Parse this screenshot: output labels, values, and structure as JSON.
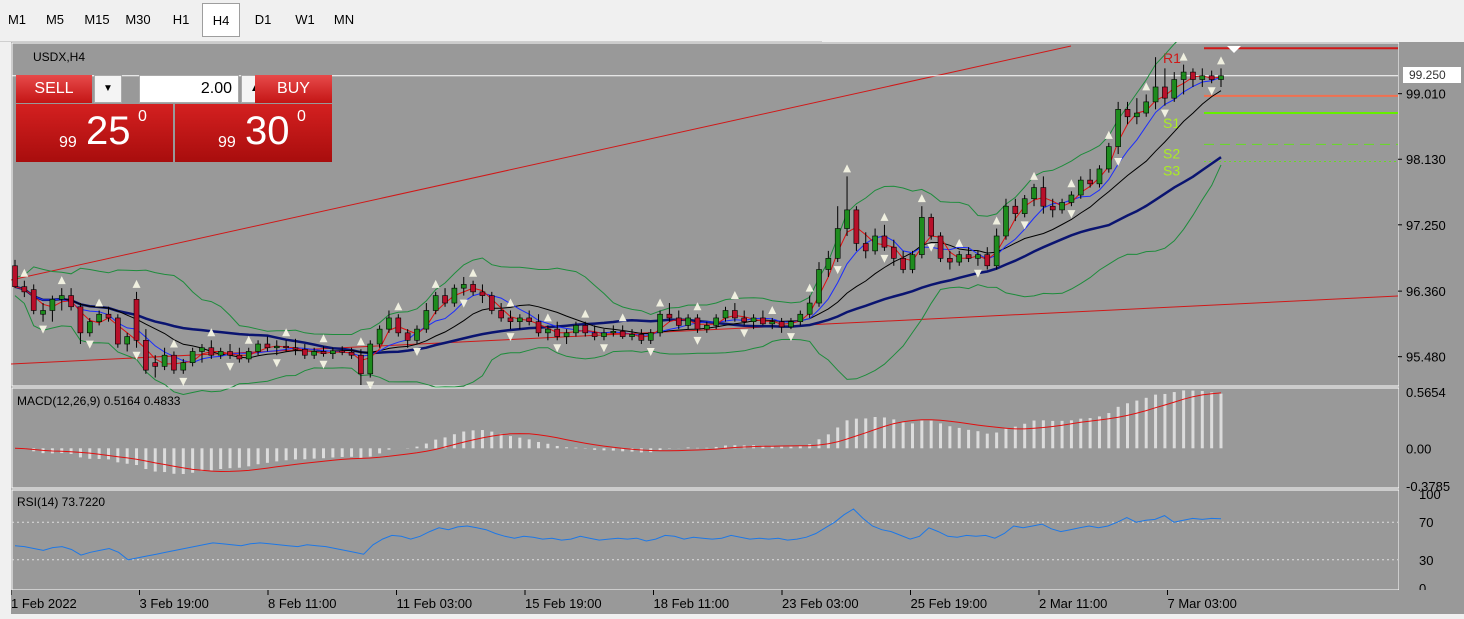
{
  "toolbar": {
    "timeframes": [
      "M1",
      "M5",
      "M15",
      "M30",
      "H1",
      "H4",
      "D1",
      "W1",
      "MN"
    ],
    "active": "H4"
  },
  "chart": {
    "symbol_label": "USDX,H4",
    "current_price_label": "99.250",
    "price_axis": [
      "99.010",
      "98.130",
      "97.250",
      "96.360",
      "95.480"
    ],
    "pivot_labels": [
      "R1",
      "S1",
      "S2",
      "S3"
    ],
    "date_axis": [
      "1 Feb 2022",
      "3 Feb 19:00",
      "8 Feb 11:00",
      "11 Feb 03:00",
      "15 Feb 19:00",
      "18 Feb 11:00",
      "23 Feb 03:00",
      "25 Feb 19:00",
      "2 Mar 11:00",
      "7 Mar 03:00"
    ]
  },
  "macd": {
    "label": "MACD(12,26,9) 0.5164 0.4833",
    "axis": [
      "0.5654",
      "0.00",
      "-0.3785"
    ]
  },
  "rsi": {
    "label": "RSI(14) 73.7220",
    "axis": [
      "100",
      "70",
      "30",
      "0"
    ]
  },
  "trade": {
    "sell_label": "SELL",
    "buy_label": "BUY",
    "lot": "2.00",
    "bid_small": "99",
    "bid_big": "25",
    "bid_sup": "0",
    "ask_small": "99",
    "ask_big": "30",
    "ask_sup": "0"
  },
  "colors": {
    "chart_bg": "#999999",
    "bull_candle": "#1e8c1e",
    "bear_candle": "#b8102a",
    "trendline": "#d01818",
    "ma_slow": "#0a1470",
    "ma_mid": "#000000",
    "ma_fast": "#1a2cff",
    "ma_red": "#e01010",
    "bollinger": "#1e8c3c",
    "macd_hist": "#dcdcdc",
    "macd_signal": "#e01010",
    "rsi_line": "#1e78e6",
    "pivot_r1": "#d01818",
    "pivot_s1": "#66ee00"
  },
  "chart_data": {
    "type": "candlestick",
    "symbol": "USDX",
    "timeframe": "H4",
    "y_range": [
      95.1,
      99.65
    ],
    "ohlc": [
      [
        96.7,
        96.78,
        96.4,
        96.42
      ],
      [
        96.42,
        96.5,
        96.28,
        96.35
      ],
      [
        96.38,
        96.45,
        96.05,
        96.1
      ],
      [
        96.05,
        96.2,
        95.95,
        96.1
      ],
      [
        96.1,
        96.3,
        95.95,
        96.25
      ],
      [
        96.25,
        96.4,
        96.1,
        96.3
      ],
      [
        96.3,
        96.4,
        96.1,
        96.15
      ],
      [
        96.15,
        96.2,
        95.65,
        95.8
      ],
      [
        95.8,
        96.0,
        95.75,
        95.95
      ],
      [
        95.95,
        96.1,
        95.9,
        96.05
      ],
      [
        96.05,
        96.15,
        95.95,
        96.0
      ],
      [
        96.0,
        96.05,
        95.6,
        95.65
      ],
      [
        95.65,
        95.8,
        95.55,
        95.75
      ],
      [
        96.25,
        96.35,
        95.6,
        95.7
      ],
      [
        95.7,
        95.85,
        95.25,
        95.3
      ],
      [
        95.4,
        95.5,
        95.2,
        95.35
      ],
      [
        95.35,
        95.6,
        95.3,
        95.5
      ],
      [
        95.5,
        95.55,
        95.25,
        95.3
      ],
      [
        95.3,
        95.45,
        95.25,
        95.4
      ],
      [
        95.4,
        95.6,
        95.35,
        95.55
      ],
      [
        95.55,
        95.65,
        95.4,
        95.6
      ],
      [
        95.6,
        95.7,
        95.45,
        95.5
      ],
      [
        95.5,
        95.6,
        95.45,
        95.55
      ],
      [
        95.55,
        95.65,
        95.45,
        95.5
      ],
      [
        95.5,
        95.6,
        95.4,
        95.45
      ],
      [
        95.45,
        95.6,
        95.4,
        95.55
      ],
      [
        95.55,
        95.7,
        95.5,
        95.65
      ],
      [
        95.65,
        95.75,
        95.55,
        95.6
      ],
      [
        95.6,
        95.7,
        95.5,
        95.62
      ],
      [
        95.62,
        95.7,
        95.55,
        95.6
      ],
      [
        95.6,
        95.72,
        95.5,
        95.58
      ],
      [
        95.58,
        95.65,
        95.45,
        95.5
      ],
      [
        95.5,
        95.6,
        95.45,
        95.55
      ],
      [
        95.55,
        95.62,
        95.48,
        95.52
      ],
      [
        95.52,
        95.6,
        95.45,
        95.56
      ],
      [
        95.56,
        95.62,
        95.5,
        95.54
      ],
      [
        95.54,
        95.6,
        95.45,
        95.5
      ],
      [
        95.5,
        95.58,
        95.1,
        95.25
      ],
      [
        95.25,
        95.7,
        95.2,
        95.65
      ],
      [
        95.65,
        95.9,
        95.6,
        95.85
      ],
      [
        95.85,
        96.1,
        95.8,
        96.0
      ],
      [
        96.0,
        96.05,
        95.75,
        95.8
      ],
      [
        95.8,
        95.85,
        95.6,
        95.7
      ],
      [
        95.7,
        95.9,
        95.65,
        95.85
      ],
      [
        95.85,
        96.2,
        95.8,
        96.1
      ],
      [
        96.1,
        96.35,
        96.05,
        96.3
      ],
      [
        96.3,
        96.4,
        96.15,
        96.2
      ],
      [
        96.2,
        96.45,
        96.15,
        96.4
      ],
      [
        96.4,
        96.55,
        96.3,
        96.45
      ],
      [
        96.45,
        96.5,
        96.3,
        96.35
      ],
      [
        96.35,
        96.45,
        96.2,
        96.3
      ],
      [
        96.3,
        96.35,
        96.05,
        96.1
      ],
      [
        96.1,
        96.2,
        95.95,
        96.0
      ],
      [
        96.0,
        96.1,
        95.85,
        95.95
      ],
      [
        95.95,
        96.05,
        95.85,
        96.0
      ],
      [
        96.0,
        96.1,
        95.9,
        95.95
      ],
      [
        95.95,
        96.05,
        95.75,
        95.8
      ],
      [
        95.8,
        95.9,
        95.7,
        95.85
      ],
      [
        95.85,
        95.95,
        95.7,
        95.75
      ],
      [
        95.75,
        95.85,
        95.65,
        95.8
      ],
      [
        95.8,
        95.95,
        95.75,
        95.9
      ],
      [
        95.9,
        95.95,
        95.75,
        95.8
      ],
      [
        95.8,
        95.9,
        95.7,
        95.75
      ],
      [
        95.75,
        95.85,
        95.7,
        95.8
      ],
      [
        95.8,
        95.9,
        95.75,
        95.82
      ],
      [
        95.82,
        95.9,
        95.72,
        95.75
      ],
      [
        95.75,
        95.85,
        95.7,
        95.78
      ],
      [
        95.78,
        95.85,
        95.65,
        95.7
      ],
      [
        95.7,
        95.85,
        95.65,
        95.8
      ],
      [
        95.8,
        96.1,
        95.75,
        96.05
      ],
      [
        96.05,
        96.2,
        95.95,
        96.0
      ],
      [
        96.0,
        96.1,
        95.85,
        95.9
      ],
      [
        95.9,
        96.05,
        95.85,
        96.0
      ],
      [
        96.0,
        96.05,
        95.8,
        95.85
      ],
      [
        95.85,
        95.95,
        95.8,
        95.9
      ],
      [
        95.9,
        96.05,
        95.85,
        96.0
      ],
      [
        96.0,
        96.15,
        95.95,
        96.1
      ],
      [
        96.1,
        96.2,
        95.95,
        96.0
      ],
      [
        96.0,
        96.1,
        95.9,
        95.95
      ],
      [
        95.95,
        96.05,
        95.85,
        96.0
      ],
      [
        96.0,
        96.1,
        95.9,
        95.92
      ],
      [
        95.92,
        96.0,
        95.85,
        95.95
      ],
      [
        95.95,
        96.0,
        95.8,
        95.88
      ],
      [
        95.88,
        96.0,
        95.85,
        95.95
      ],
      [
        95.95,
        96.1,
        95.9,
        96.05
      ],
      [
        96.05,
        96.3,
        96.0,
        96.2
      ],
      [
        96.2,
        96.75,
        96.15,
        96.65
      ],
      [
        96.65,
        96.9,
        96.55,
        96.8
      ],
      [
        96.8,
        97.5,
        96.75,
        97.2
      ],
      [
        97.2,
        97.9,
        97.1,
        97.45
      ],
      [
        97.45,
        97.5,
        96.9,
        97.0
      ],
      [
        97.0,
        97.15,
        96.8,
        96.9
      ],
      [
        96.9,
        97.2,
        96.85,
        97.1
      ],
      [
        97.1,
        97.25,
        96.9,
        96.95
      ],
      [
        96.95,
        97.05,
        96.7,
        96.8
      ],
      [
        96.8,
        96.9,
        96.6,
        96.65
      ],
      [
        96.65,
        96.9,
        96.6,
        96.85
      ],
      [
        96.85,
        97.5,
        96.8,
        97.35
      ],
      [
        97.35,
        97.4,
        97.05,
        97.1
      ],
      [
        97.1,
        97.15,
        96.75,
        96.8
      ],
      [
        96.8,
        96.9,
        96.65,
        96.75
      ],
      [
        96.75,
        96.9,
        96.7,
        96.85
      ],
      [
        96.85,
        96.95,
        96.75,
        96.8
      ],
      [
        96.8,
        96.9,
        96.7,
        96.85
      ],
      [
        96.85,
        96.95,
        96.65,
        96.7
      ],
      [
        96.7,
        97.2,
        96.65,
        97.1
      ],
      [
        97.1,
        97.6,
        97.05,
        97.5
      ],
      [
        97.5,
        97.6,
        97.3,
        97.4
      ],
      [
        97.4,
        97.65,
        97.35,
        97.6
      ],
      [
        97.6,
        97.8,
        97.5,
        97.75
      ],
      [
        97.75,
        97.9,
        97.4,
        97.5
      ],
      [
        97.5,
        97.6,
        97.35,
        97.45
      ],
      [
        97.45,
        97.6,
        97.4,
        97.55
      ],
      [
        97.55,
        97.7,
        97.5,
        97.65
      ],
      [
        97.65,
        97.9,
        97.6,
        97.85
      ],
      [
        97.85,
        98.0,
        97.75,
        97.8
      ],
      [
        97.8,
        98.05,
        97.75,
        98.0
      ],
      [
        98.0,
        98.35,
        97.95,
        98.3
      ],
      [
        98.3,
        98.9,
        98.2,
        98.8
      ],
      [
        98.8,
        98.9,
        98.6,
        98.7
      ],
      [
        98.7,
        98.95,
        98.6,
        98.75
      ],
      [
        98.75,
        99.0,
        98.7,
        98.9
      ],
      [
        98.9,
        99.5,
        98.8,
        99.1
      ],
      [
        99.1,
        99.35,
        98.85,
        98.95
      ],
      [
        98.95,
        99.3,
        98.9,
        99.2
      ],
      [
        99.2,
        99.4,
        99.0,
        99.3
      ],
      [
        99.3,
        99.35,
        99.1,
        99.2
      ],
      [
        99.2,
        99.35,
        99.1,
        99.25
      ],
      [
        99.25,
        99.32,
        99.15,
        99.2
      ],
      [
        99.2,
        99.35,
        99.1,
        99.25
      ]
    ],
    "rsi": [
      45,
      44,
      42,
      40,
      43,
      44,
      41,
      35,
      38,
      40,
      42,
      38,
      30,
      32,
      34,
      36,
      38,
      40,
      42,
      44,
      46,
      48,
      47,
      46,
      45,
      47,
      48,
      47,
      46,
      45,
      44,
      46,
      45,
      44,
      42,
      40,
      38,
      36,
      46,
      52,
      56,
      55,
      52,
      55,
      60,
      64,
      62,
      65,
      66,
      64,
      62,
      58,
      55,
      53,
      55,
      54,
      52,
      53,
      51,
      52,
      55,
      53,
      51,
      52,
      53,
      52,
      53,
      50,
      52,
      56,
      55,
      52,
      54,
      53,
      52,
      53,
      56,
      54,
      52,
      53,
      52,
      53,
      51,
      52,
      54,
      58,
      64,
      70,
      78,
      84,
      74,
      66,
      62,
      60,
      56,
      52,
      55,
      64,
      60,
      55,
      54,
      56,
      55,
      56,
      53,
      58,
      66,
      64,
      66,
      68,
      63,
      60,
      62,
      64,
      66,
      64,
      66,
      70,
      75,
      70,
      72,
      73,
      77,
      70,
      72,
      74,
      73,
      74,
      73.7
    ]
  }
}
